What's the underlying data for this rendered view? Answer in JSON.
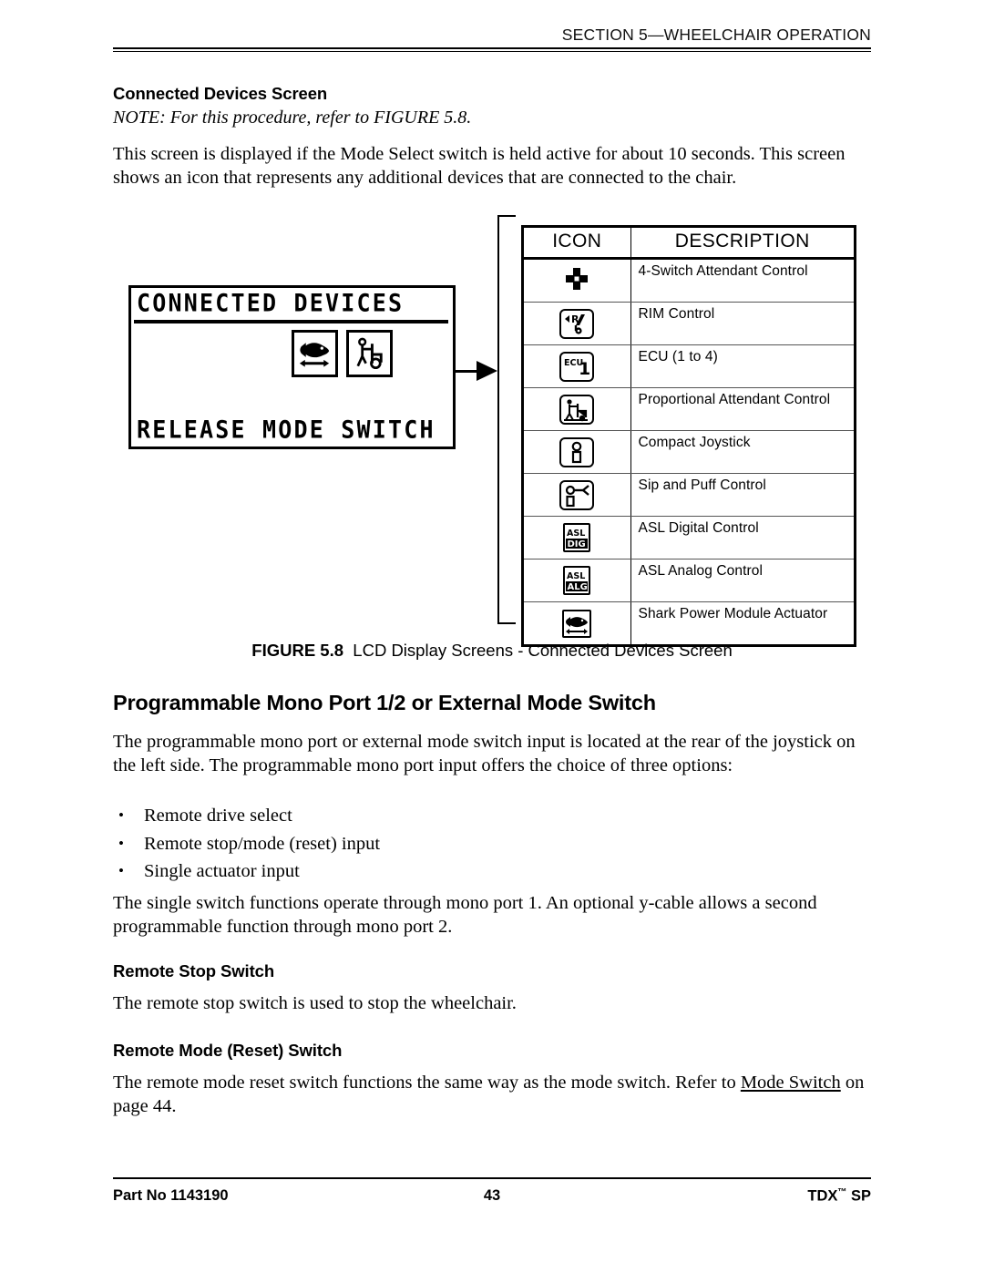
{
  "header": {
    "section_title": "SECTION 5—WHEELCHAIR OPERATION"
  },
  "content": {
    "heading_connected_devices": "Connected Devices Screen",
    "note": "NOTE: For this procedure, refer to FIGURE 5.8.",
    "intro_paragraph": "This screen is displayed if the Mode Select switch is held active for about 10 seconds. This screen shows an icon that represents any additional devices that are connected to the chair.",
    "heading_mono_port": "Programmable Mono Port 1/2 or External Mode Switch",
    "mono_port_paragraph": "The programmable mono port or external mode switch input is located at the rear of the joystick on the left side. The programmable mono port input offers the choice of three options:",
    "bullets": [
      "Remote drive select",
      "Remote stop/mode (reset) input",
      "Single actuator input"
    ],
    "bullet_glyph": "•",
    "single_switch_paragraph": "The single switch functions operate through mono port 1. An optional y-cable allows a second programmable function through mono port 2.",
    "heading_remote_stop": "Remote Stop Switch",
    "remote_stop_paragraph": "The remote stop switch is used to stop the wheelchair.",
    "heading_remote_mode": "Remote Mode (Reset) Switch",
    "remote_mode_paragraph_before": "The remote mode reset switch functions the same way as the mode switch. Refer to ",
    "remote_mode_xref": "Mode Switch",
    "remote_mode_paragraph_after": " on page 44."
  },
  "lcd_screen": {
    "title_line": "CONNECTED DEVICES",
    "bottom_line": "RELEASE MODE SWITCH",
    "icons": [
      {
        "name": "shark-power-module-actuator-icon"
      },
      {
        "name": "proportional-attendant-control-icon"
      }
    ]
  },
  "device_table": {
    "columns": [
      "ICON",
      "DESCRIPTION"
    ],
    "rows": [
      {
        "icon": "four-switch-attendant-control-icon",
        "description": "4-Switch Attendant Control"
      },
      {
        "icon": "rim-control-icon",
        "description": "RIM Control"
      },
      {
        "icon": "ecu-icon",
        "description": "ECU (1 to 4)"
      },
      {
        "icon": "proportional-attendant-control-icon",
        "description": "Proportional Attendant Control"
      },
      {
        "icon": "compact-joystick-icon",
        "description": "Compact Joystick"
      },
      {
        "icon": "sip-and-puff-control-icon",
        "description": "Sip and Puff Control"
      },
      {
        "icon": "asl-digital-control-icon",
        "description": "ASL Digital Control"
      },
      {
        "icon": "asl-analog-control-icon",
        "description": "ASL Analog Control"
      },
      {
        "icon": "shark-power-module-actuator-icon",
        "description": "Shark Power Module Actuator"
      }
    ],
    "icon_labels": {
      "ecu_prefix": "ECU",
      "ecu_number": "1",
      "rim_letter": "R",
      "asl_top": "ASL",
      "asl_dig": "DIG",
      "asl_alg": "ALG"
    }
  },
  "figure": {
    "label": "FIGURE 5.8",
    "caption": "LCD Display Screens - Connected Devices Screen"
  },
  "footer": {
    "part_no": "Part No 1143190",
    "page_number": "43",
    "product_name": "TDX",
    "product_tm": "™",
    "product_suffix": "SP"
  }
}
